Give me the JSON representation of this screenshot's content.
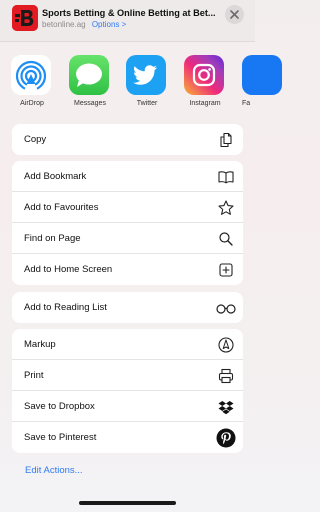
{
  "header": {
    "title": "Sports Betting & Online Betting at Bet...",
    "domain": "betonline.ag",
    "options_label": "Options >"
  },
  "apps": [
    {
      "label": "AirDrop",
      "icon": "airdrop-icon",
      "color": "#ffffff"
    },
    {
      "label": "Messages",
      "icon": "messages-icon",
      "color": "#4cd964"
    },
    {
      "label": "Twitter",
      "icon": "twitter-icon",
      "color": "#1da1f2"
    },
    {
      "label": "Instagram",
      "icon": "instagram-icon",
      "color": "#c13584"
    },
    {
      "label": "Fa",
      "icon": "facebook-icon",
      "color": "#1877f2"
    }
  ],
  "groups": [
    {
      "rows": [
        {
          "label": "Copy",
          "icon": "copy-icon"
        }
      ]
    },
    {
      "rows": [
        {
          "label": "Add Bookmark",
          "icon": "book-icon"
        },
        {
          "label": "Add to Favourites",
          "icon": "star-icon"
        },
        {
          "label": "Find on Page",
          "icon": "search-icon"
        },
        {
          "label": "Add to Home Screen",
          "icon": "plus-square-icon"
        }
      ]
    },
    {
      "rows": [
        {
          "label": "Add to Reading List",
          "icon": "glasses-icon"
        }
      ]
    },
    {
      "rows": [
        {
          "label": "Markup",
          "icon": "markup-icon"
        },
        {
          "label": "Print",
          "icon": "printer-icon"
        },
        {
          "label": "Save to Dropbox",
          "icon": "dropbox-icon"
        },
        {
          "label": "Save to Pinterest",
          "icon": "pinterest-icon"
        }
      ]
    }
  ],
  "footer": {
    "edit_actions": "Edit Actions..."
  },
  "colors": {
    "accent": "#2f7bf5",
    "brand": "#e21b23"
  }
}
